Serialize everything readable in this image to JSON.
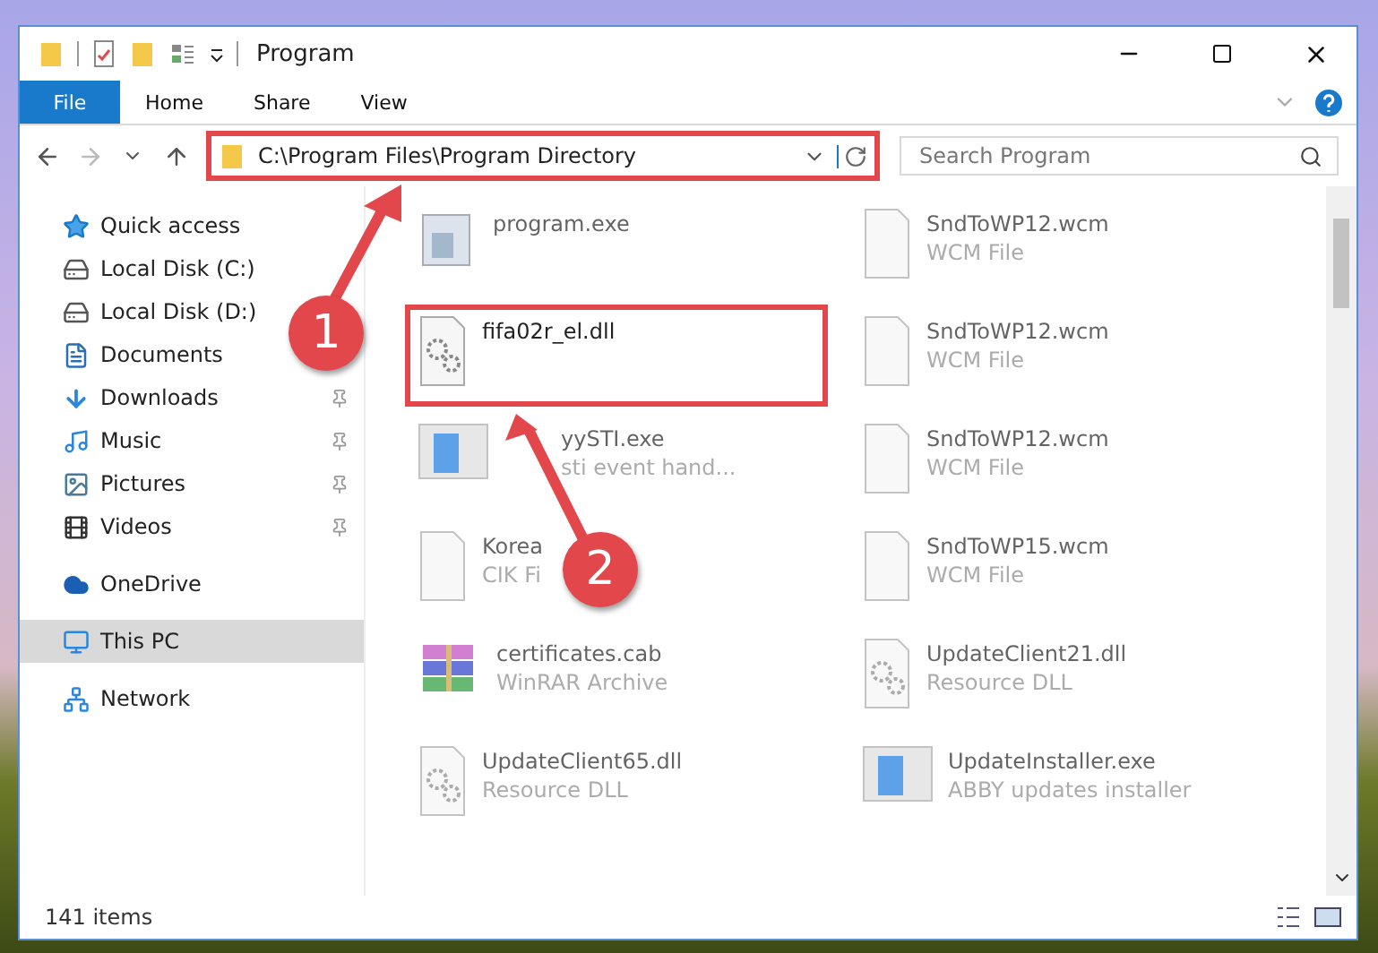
{
  "window": {
    "title": "Program"
  },
  "ribbon": {
    "tabs": [
      {
        "label": "File",
        "kind": "file"
      },
      {
        "label": "Home",
        "kind": "tab"
      },
      {
        "label": "Share",
        "kind": "tab"
      },
      {
        "label": "View",
        "kind": "tab"
      }
    ]
  },
  "address_bar": {
    "path": "C:\\Program Files\\Program Directory",
    "highlighted": true
  },
  "search": {
    "placeholder": "Search Program"
  },
  "sidebar": {
    "groups": [
      {
        "items": [
          {
            "label": "Quick access",
            "kind": "quick",
            "pinned": false,
            "selected": false
          },
          {
            "label": "Local Disk (C:)",
            "kind": "sysdrive",
            "pinned": false,
            "selected": false
          },
          {
            "label": "Local Disk (D:)",
            "kind": "drive",
            "pinned": false,
            "selected": false
          },
          {
            "label": "Documents",
            "kind": "documents",
            "pinned": false,
            "selected": false
          },
          {
            "label": "Downloads",
            "kind": "downloads",
            "pinned": true,
            "selected": false
          },
          {
            "label": "Music",
            "kind": "music",
            "pinned": true,
            "selected": false
          },
          {
            "label": "Pictures",
            "kind": "pictures",
            "pinned": true,
            "selected": false
          },
          {
            "label": "Videos",
            "kind": "videos",
            "pinned": true,
            "selected": false
          }
        ]
      },
      {
        "items": [
          {
            "label": "OneDrive",
            "kind": "cloud",
            "pinned": false,
            "selected": false
          }
        ]
      },
      {
        "items": [
          {
            "label": "This PC",
            "kind": "pc",
            "pinned": false,
            "selected": true
          }
        ]
      },
      {
        "items": [
          {
            "label": "Network",
            "kind": "network",
            "pinned": false,
            "selected": false
          }
        ]
      }
    ]
  },
  "files": [
    {
      "name": "program.exe",
      "kind": "app",
      "faded": true,
      "highlighted": false,
      "covered": false
    },
    {
      "name": "SndToWP12.wcm",
      "type": "WCM File",
      "kind": "blank",
      "faded": true,
      "highlighted": false,
      "covered": false
    },
    {
      "name": "fifa02r_el.dll",
      "kind": "gears",
      "faded": false,
      "highlighted": true,
      "covered": false
    },
    {
      "name": "SndToWP12.wcm",
      "type": "WCM File",
      "kind": "blank",
      "faded": true,
      "highlighted": false,
      "covered": false
    },
    {
      "name": "yySTI.exe",
      "type": "sti event hand...",
      "kind": "installer",
      "faded": true,
      "highlighted": false,
      "covered": true
    },
    {
      "name": "SndToWP12.wcm",
      "type": "WCM File",
      "kind": "blank",
      "faded": true,
      "highlighted": false,
      "covered": false
    },
    {
      "name": "Korea",
      "type": "CIK Fi",
      "kind": "blank",
      "faded": true,
      "highlighted": false,
      "covered": false
    },
    {
      "name": "SndToWP15.wcm",
      "type": "WCM File",
      "kind": "blank",
      "faded": true,
      "highlighted": false,
      "covered": false
    },
    {
      "name": "certificates.cab",
      "type": "WinRAR Archive",
      "kind": "archive",
      "faded": true,
      "highlighted": false,
      "covered": false
    },
    {
      "name": "UpdateClient21.dll",
      "type": "Resource DLL",
      "kind": "gears",
      "faded": true,
      "highlighted": false,
      "covered": false
    },
    {
      "name": "UpdateClient65.dll",
      "type": "Resource DLL",
      "kind": "gears",
      "faded": true,
      "highlighted": false,
      "covered": false
    },
    {
      "name": "UpdateInstaller.exe",
      "type": "ABBY updates installer",
      "kind": "installer",
      "faded": true,
      "highlighted": false,
      "covered": false
    }
  ],
  "callouts": [
    {
      "number": "1"
    },
    {
      "number": "2"
    }
  ],
  "status_bar": {
    "count": "141 items"
  }
}
